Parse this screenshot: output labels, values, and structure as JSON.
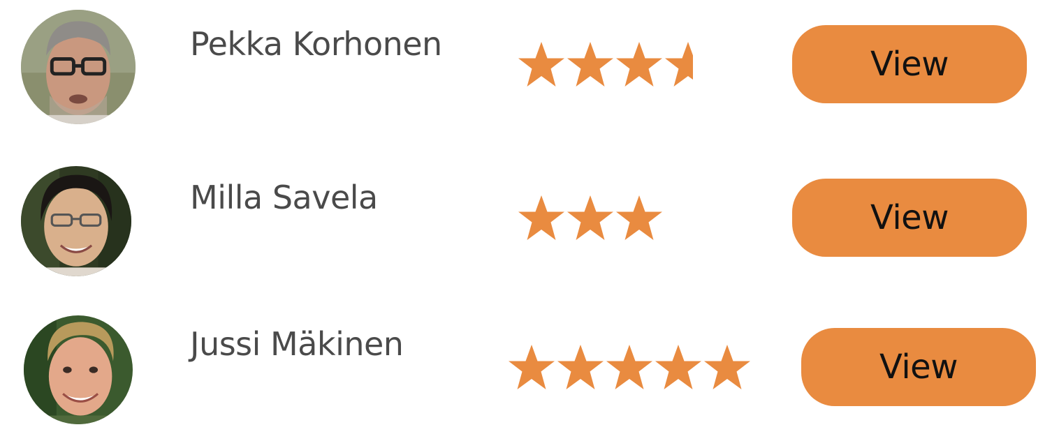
{
  "accent_color": "#E98B40",
  "people": [
    {
      "name": "Pekka Korhonen",
      "rating": 3.6,
      "max_rating": 5,
      "button_label": "View"
    },
    {
      "name": "Milla Savela",
      "rating": 3,
      "max_rating": 5,
      "button_label": "View"
    },
    {
      "name": "Jussi Mäkinen",
      "rating": 5,
      "max_rating": 5,
      "button_label": "View"
    }
  ]
}
